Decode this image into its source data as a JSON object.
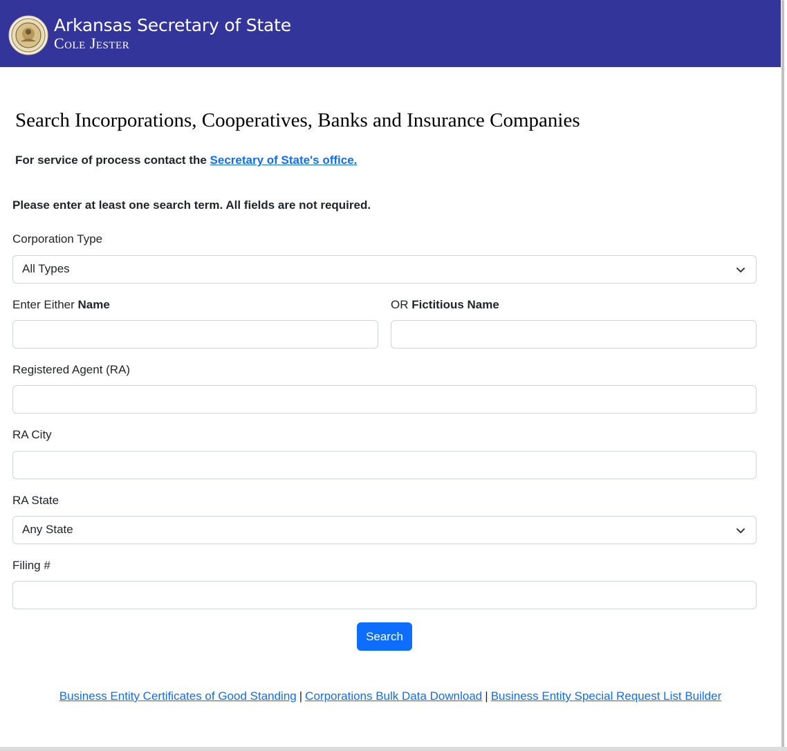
{
  "header": {
    "title": "Arkansas Secretary of State",
    "official_name": "Cole Jester",
    "colors": {
      "banner": "#34359a",
      "text": "#ffffff"
    },
    "seal_icon": "state-seal-icon"
  },
  "main": {
    "page_title": "Search Incorporations, Cooperatives, Banks and Insurance Companies",
    "service_note_prefix": "For service of process contact the ",
    "service_note_link": "Secretary of State's office.",
    "instructions": "Please enter at least one search term. All fields are not required."
  },
  "form": {
    "corporation_type": {
      "label": "Corporation Type",
      "selected": "All Types"
    },
    "name": {
      "label_prefix": "Enter Either ",
      "label_bold": "Name",
      "value": ""
    },
    "fictitious_name": {
      "label_prefix": "OR ",
      "label_bold": "Fictitious Name",
      "value": ""
    },
    "registered_agent": {
      "label": "Registered Agent (RA)",
      "value": ""
    },
    "ra_city": {
      "label": "RA City",
      "value": ""
    },
    "ra_state": {
      "label": "RA State",
      "selected": "Any State"
    },
    "filing_number": {
      "label": "Filing #",
      "value": ""
    },
    "search_button": "Search"
  },
  "footer": {
    "links": [
      "Business Entity Certificates of Good Standing",
      "Corporations Bulk Data Download",
      "Business Entity Special Request List Builder"
    ],
    "separator": "|"
  },
  "colors": {
    "accent": "#0d6efd",
    "border": "#ced4da"
  }
}
